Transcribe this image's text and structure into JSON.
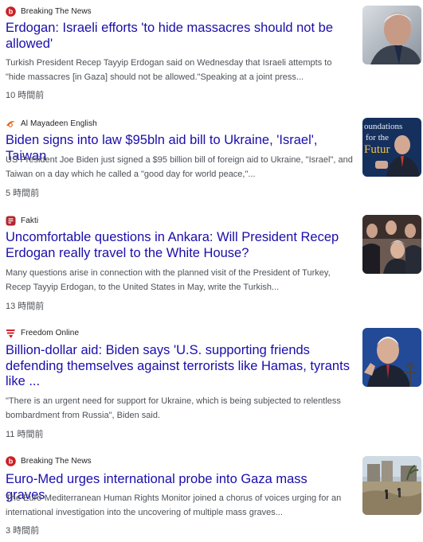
{
  "articles": [
    {
      "source": "Breaking The News",
      "source_icon": "breaking-the-news-logo",
      "title": "Erdogan: Israeli efforts 'to hide massacres should not be allowed'",
      "snippet": "Turkish President Recep Tayyip Erdogan said on Wednesday that Israeli attempts to \"hide massacres [in Gaza] should not be allowed.\"Speaking at a joint press...",
      "time": "10 時間前"
    },
    {
      "source": "Al Mayadeen English",
      "source_icon": "al-mayadeen-logo",
      "title": "Biden signs into law $95bln aid bill to Ukraine, 'Israel', Taiwan",
      "snippet": "US President Joe Biden just signed a $95 billion bill of foreign aid to Ukraine, \"Israel\", and Taiwan on a day which he called a \"good day for world peace,\"...",
      "time": "5 時間前",
      "thumb_text": "oundations for the Futur"
    },
    {
      "source": "Fakti",
      "source_icon": "fakti-logo",
      "title": "Uncomfortable questions in Ankara: Will President Recep Erdogan really travel to the White House?",
      "snippet": "Many questions arise in connection with the planned visit of the President of Turkey, Recep Tayyip Erdogan, to the United States in May, write the Turkish...",
      "time": "13 時間前"
    },
    {
      "source": "Freedom Online",
      "source_icon": "freedom-online-logo",
      "title": "Billion-dollar aid: Biden says 'U.S. supporting friends defending themselves against terrorists like Hamas, tyrants like ...",
      "snippet": "\"There is an urgent need for support for Ukraine, which is being subjected to relentless bombardment from Russia\", Biden said.",
      "time": "11 時間前"
    },
    {
      "source": "Breaking The News",
      "source_icon": "breaking-the-news-logo",
      "title": "Euro-Med urges international probe into Gaza mass graves",
      "snippet": "The Euro-Mediterranean Human Rights Monitor joined a chorus of voices urging for an international investigation into the uncovering of multiple mass graves...",
      "time": "3 時間前"
    }
  ],
  "colors": {
    "title_link": "#1a0dab",
    "snippet_text": "#4d5156",
    "source_text": "#202124",
    "breaking_logo": "#cc1f26",
    "al_mayadeen_logo": "#e0651d",
    "fakti_logo": "#b3262e",
    "freedom_logo": "#d6202b"
  }
}
